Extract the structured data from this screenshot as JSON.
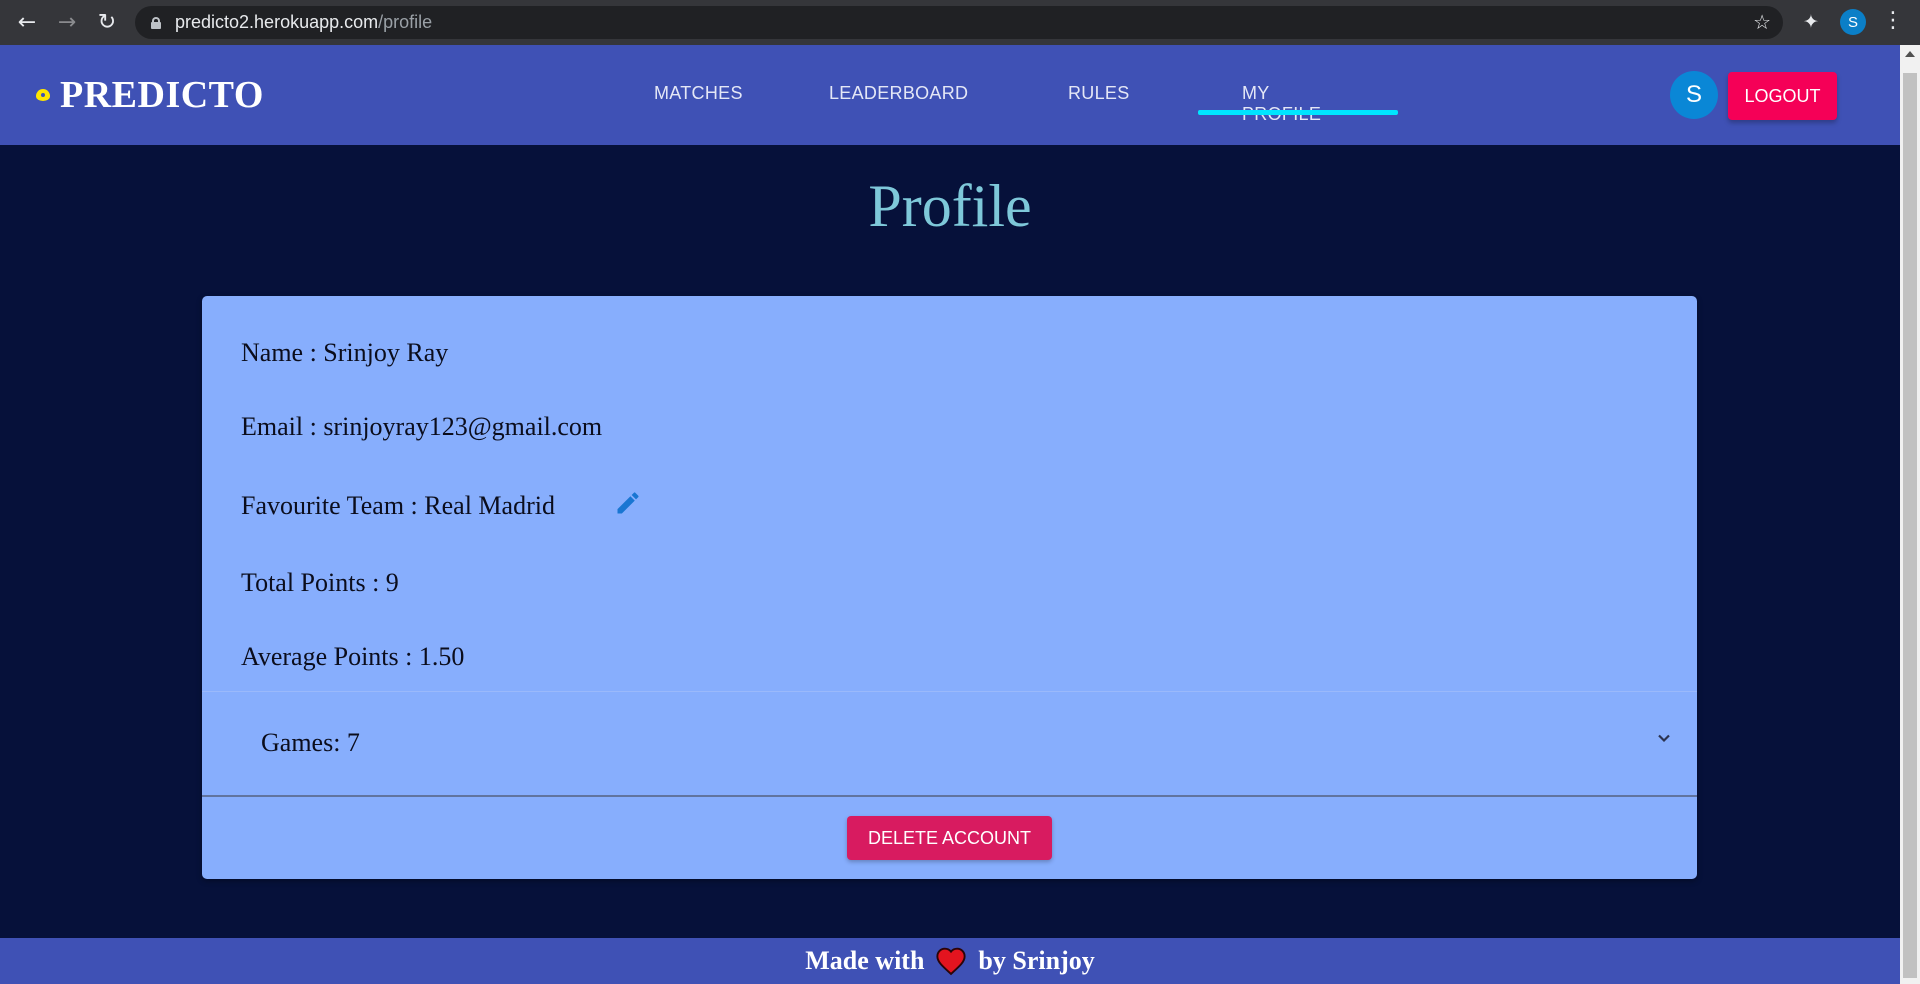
{
  "browser": {
    "url_host": "predicto2.herokuapp.com",
    "url_path": "/profile",
    "profile_initial": "S"
  },
  "header": {
    "logo_text": "PREDICTO",
    "nav": [
      {
        "label": "MATCHES",
        "active": false
      },
      {
        "label": "LEADERBOARD",
        "active": false
      },
      {
        "label": "RULES",
        "active": false
      },
      {
        "label": "MY PROFILE",
        "active": true
      }
    ],
    "avatar_initial": "S",
    "logout_label": "LOGOUT"
  },
  "page": {
    "title": "Profile"
  },
  "profile": {
    "name": "Name : Srinjoy Ray",
    "email": "Email : srinjoyray123@gmail.com",
    "favourite_team": "Favourite Team : Real Madrid",
    "total_points": "Total Points : 9",
    "average_points": "Average Points : 1.50",
    "games": "Games: 7",
    "delete_label": "DELETE ACCOUNT"
  },
  "footer": {
    "made_with": "Made with",
    "by": "by Srinjoy"
  },
  "colors": {
    "background": "#06113a",
    "appbar": "#3f51b5",
    "accent_underline": "#00e5ff",
    "logout": "#f50057",
    "delete": "#d81b60",
    "card": "#87aefd",
    "title": "#7ec8d9"
  },
  "icons": {
    "edit": "pencil-icon",
    "expand": "chevron-down-icon",
    "heart": "heart-icon"
  }
}
